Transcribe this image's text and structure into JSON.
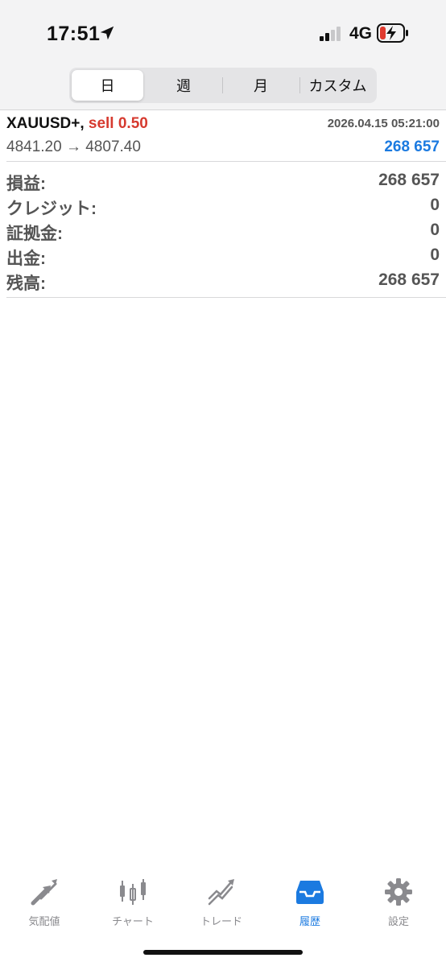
{
  "status_bar": {
    "time": "17:51",
    "network": "4G",
    "location_icon": "location-arrow-icon",
    "signal_icon": "cellular-signal-icon",
    "battery_icon": "battery-charging-icon"
  },
  "period_tabs": [
    {
      "label": "日",
      "active": true
    },
    {
      "label": "週",
      "active": false
    },
    {
      "label": "月",
      "active": false
    },
    {
      "label": "カスタム",
      "active": false
    }
  ],
  "deal": {
    "symbol": "XAUUSD+,",
    "side": "sell 0.50",
    "datetime": "2026.04.15 05:21:00",
    "prices": "4841.20 → 4807.40",
    "profit": "268 657"
  },
  "summary": [
    {
      "label": "損益:",
      "value": "268 657"
    },
    {
      "label": "クレジット:",
      "value": "0"
    },
    {
      "label": "証拠金:",
      "value": "0"
    },
    {
      "label": "出金:",
      "value": "0"
    },
    {
      "label": "残高:",
      "value": "268 657"
    }
  ],
  "tabbar": [
    {
      "label": "気配値",
      "icon": "quotes-arrows-icon",
      "active": false
    },
    {
      "label": "チャート",
      "icon": "candlestick-chart-icon",
      "active": false
    },
    {
      "label": "トレード",
      "icon": "trade-trend-icon",
      "active": false
    },
    {
      "label": "履歴",
      "icon": "history-inbox-icon",
      "active": true
    },
    {
      "label": "設定",
      "icon": "gear-icon",
      "active": false
    }
  ],
  "colors": {
    "accent_blue": "#1b7ae0",
    "sell_red": "#d63a2f",
    "inactive_gray": "#8a8a8e"
  }
}
